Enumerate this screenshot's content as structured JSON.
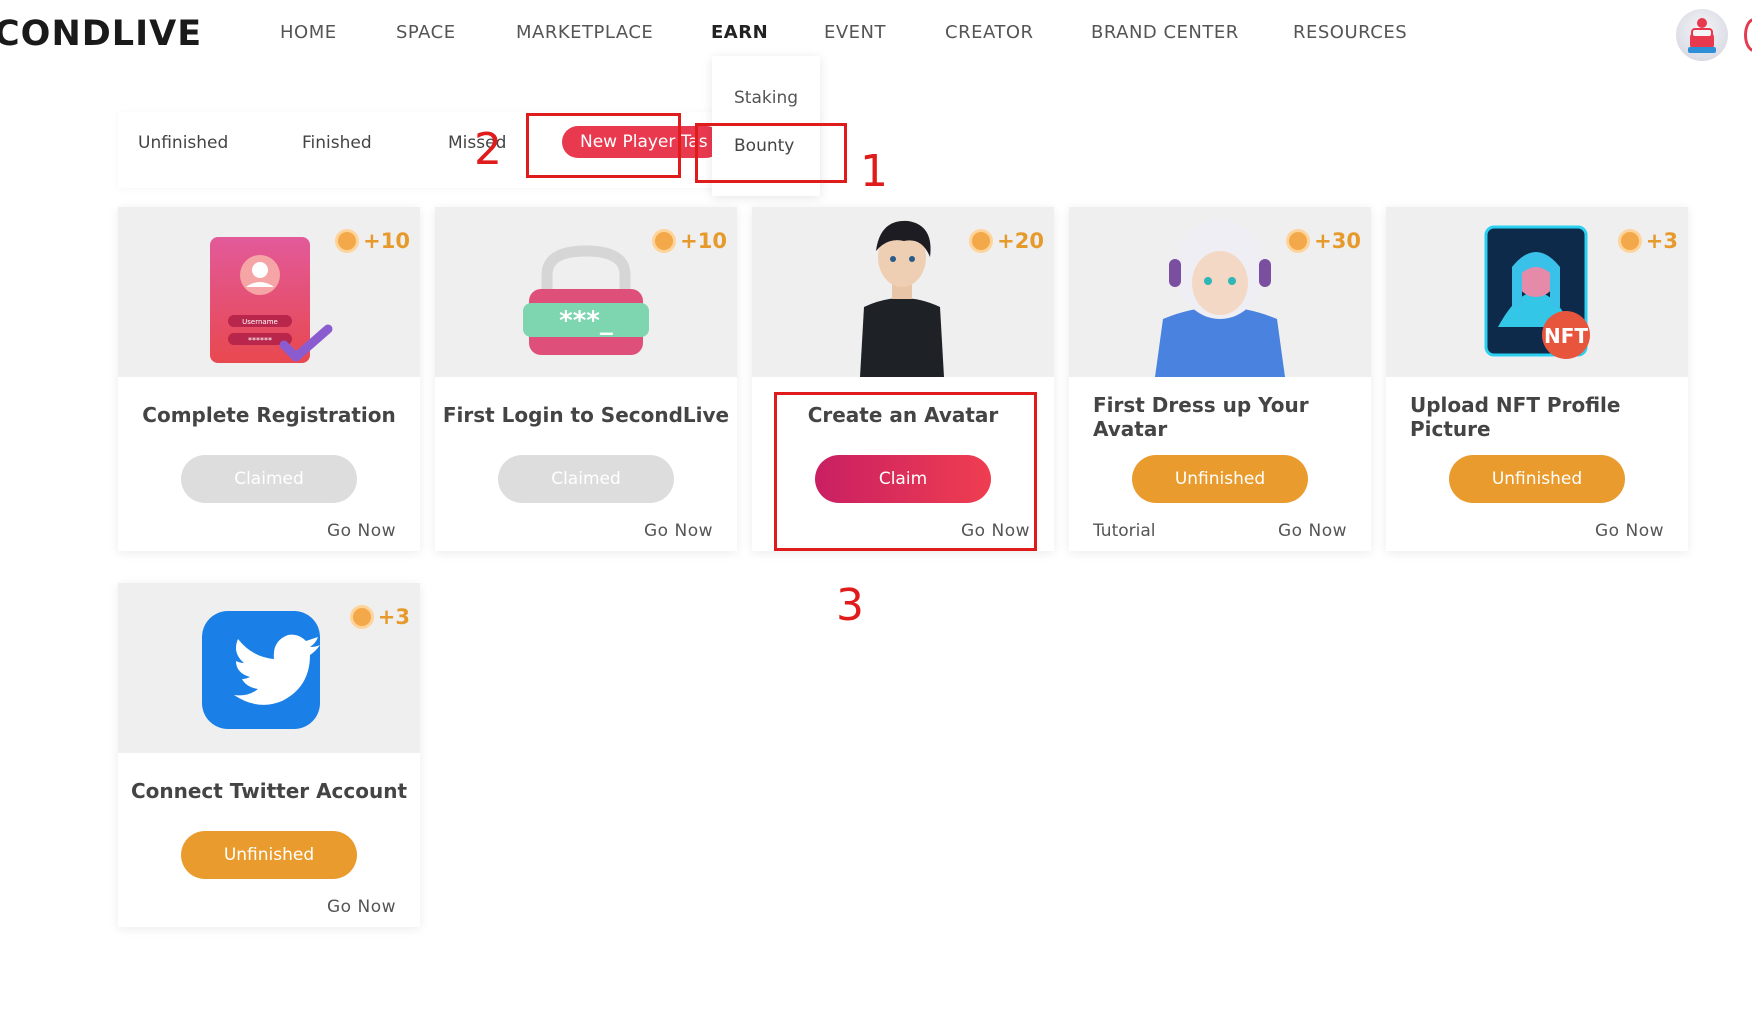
{
  "header": {
    "logo": "CONDLIVE",
    "nav": [
      "HOME",
      "SPACE",
      "MARKETPLACE",
      "EARN",
      "EVENT",
      "CREATOR",
      "BRAND CENTER",
      "RESOURCES"
    ],
    "active_nav": "EARN"
  },
  "dropdown": {
    "items": [
      "Staking",
      "Bounty"
    ]
  },
  "tabs": {
    "items": [
      "Unfinished",
      "Finished",
      "Missed"
    ],
    "active": "New Player Tas"
  },
  "annotations": [
    "1",
    "2",
    "3"
  ],
  "cards": [
    {
      "title": "Complete Registration",
      "reward": "+10",
      "button": "Claimed",
      "go": "Go Now"
    },
    {
      "title": "First Login to SecondLive",
      "reward": "+10",
      "button": "Claimed",
      "go": "Go Now"
    },
    {
      "title": "Create an Avatar",
      "reward": "+20",
      "button": "Claim",
      "go": "Go Now"
    },
    {
      "title": "First Dress up Your Avatar",
      "reward": "+30",
      "button": "Unfinished",
      "go": "Go Now",
      "tutorial": "Tutorial"
    },
    {
      "title": "Upload NFT Profile Picture",
      "reward": "+3",
      "button": "Unfinished",
      "go": "Go Now"
    },
    {
      "title": "Connect Twitter Account",
      "reward": "+3",
      "button": "Unfinished",
      "go": "Go Now"
    }
  ],
  "icon_labels": {
    "username": "Username",
    "password": "******",
    "password_field": "***_",
    "nft": "NFT"
  },
  "colors": {
    "accent_red": "#e8394f",
    "claim_gradient_start": "#c91f63",
    "unfinished_orange": "#ea9b2d",
    "coin": "#f3a84a",
    "annotation_red": "#e01b1b"
  }
}
